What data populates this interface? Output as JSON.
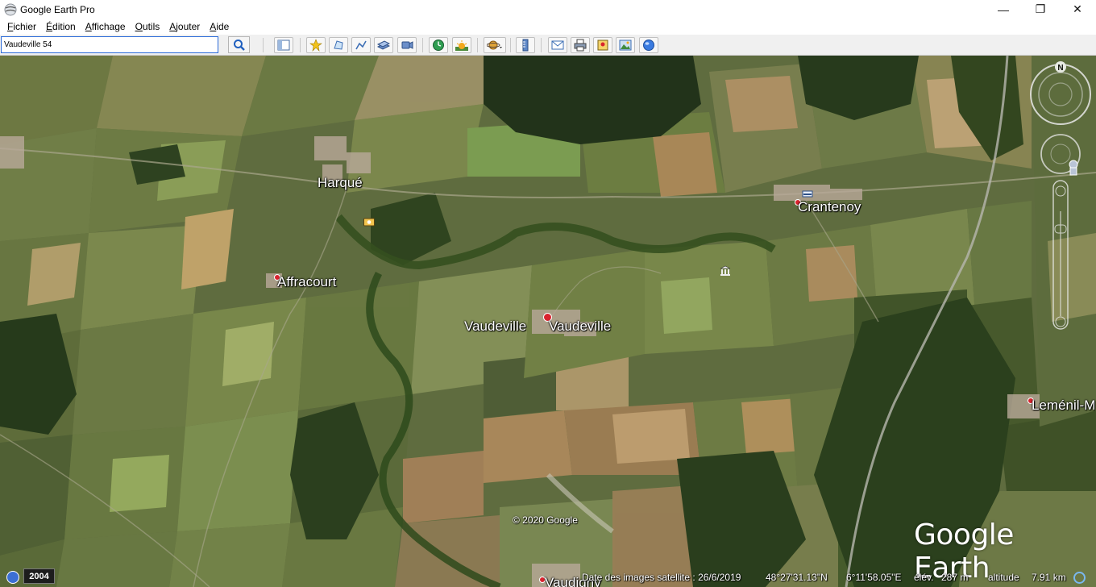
{
  "window": {
    "title": "Google Earth Pro",
    "minimize": "—",
    "maximize": "❐",
    "close": "✕"
  },
  "menu": [
    {
      "label": "Fichier",
      "u": "F",
      "rest": "ichier"
    },
    {
      "label": "Édition",
      "u": "É",
      "rest": "dition"
    },
    {
      "label": "Affichage",
      "u": "A",
      "rest": "ffichage"
    },
    {
      "label": "Outils",
      "u": "O",
      "rest": "utils"
    },
    {
      "label": "Ajouter",
      "u": "A",
      "rest": "jouter"
    },
    {
      "label": "Aide",
      "u": "A",
      "rest": "ide"
    }
  ],
  "search": {
    "value": "Vaudeville 54"
  },
  "toolbar": {
    "icons": [
      "sidebar-icon",
      "placemark-icon",
      "polygon-icon",
      "path-icon",
      "overlay-icon",
      "record-tour-icon",
      "historical-imagery-icon",
      "sunlight-icon",
      "planets-icon",
      "ruler-icon",
      "email-icon",
      "print-icon",
      "save-image-icon",
      "maps-icon",
      "web-globe-icon"
    ]
  },
  "map": {
    "places": [
      {
        "name": "Harqué",
        "pin": false
      },
      {
        "name": "Crantenoy",
        "pin": true
      },
      {
        "name": "Affracourt",
        "pin": true
      },
      {
        "name": "Vaudeville",
        "pin": false
      },
      {
        "name": "Vaudeville",
        "pin": true
      },
      {
        "name": "Leménil-M",
        "pin": true
      },
      {
        "name": "Vaudigny",
        "pin": true
      }
    ],
    "copyright": "© 2020 Google",
    "logo": "Google Earth",
    "compass_label": "N"
  },
  "status": {
    "year": "2004",
    "imagery_date": "Date des images satellite : 26/6/2019",
    "lat": "48°27'31.13\"N",
    "lon": "6°11'58.05\"E",
    "elev_label": "élév.",
    "elev_value": "287 m",
    "altitude_label": "altitude",
    "altitude_value": "7.91 km"
  }
}
